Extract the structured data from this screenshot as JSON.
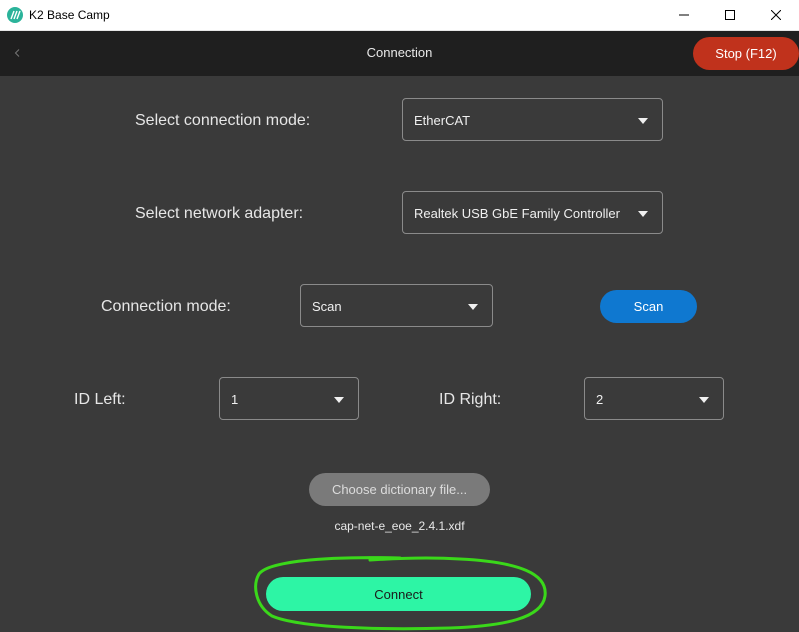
{
  "window": {
    "title": "K2 Base Camp",
    "accent": "#2bb39a"
  },
  "header": {
    "title": "Connection",
    "back_icon": "chevron-left-icon",
    "stop_label": "Stop (F12)",
    "stop_color": "#c0321c"
  },
  "form": {
    "connection_mode_select": {
      "label": "Select connection mode:",
      "value": "EtherCAT"
    },
    "network_adapter_select": {
      "label": "Select network adapter:",
      "value": "Realtek USB GbE Family Controller"
    },
    "connection_mode": {
      "label": "Connection mode:",
      "value": "Scan"
    },
    "scan_label": "Scan",
    "id_left": {
      "label": "ID Left:",
      "value": "1"
    },
    "id_right": {
      "label": "ID Right:",
      "value": "2"
    },
    "dictionary_button_label": "Choose dictionary file...",
    "dictionary_filename": "cap-net-e_eoe_2.4.1.xdf",
    "connect_label": "Connect",
    "connect_color": "#2df5a5",
    "highlight_color": "#3ad81a"
  }
}
